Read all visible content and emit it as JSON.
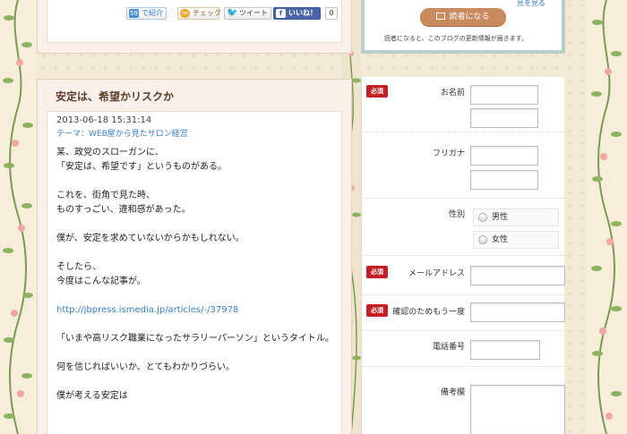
{
  "share": {
    "shokai_label": "で紹介",
    "shokai_icon": "59",
    "check_label": "チェック",
    "check_icon": "m",
    "tweet_label": "ツイート",
    "like_label": "いいね！",
    "like_icon": "f",
    "like_count": "0"
  },
  "reader": {
    "top_link": "見を見る",
    "button_label": "読者になる",
    "note": "読者になると、このブログの更新情報が届きます。"
  },
  "article": {
    "title": "安定は、希望かリスクか",
    "date": "2013-06-18 15:31:14",
    "theme_label": "テーマ：",
    "theme": "WEB屋から見たサロン経営",
    "paragraphs": [
      [
        "某、政党のスローガンに、",
        "「安定は、希望です」というものがある。"
      ],
      [
        "これを、街角で見た時、",
        "ものすっごい、違和感があった。"
      ],
      [
        "僕が、安定を求めていないからかもしれない。"
      ],
      [
        "そしたら、",
        "今度はこんな記事が。"
      ]
    ],
    "link": "http://jbpress.ismedia.jp/articles/-/37978",
    "quote": "「いまや高リスク職業になったサラリーパーソン」というタイトル。",
    "after": "何を信じればいいか、とてもわかりづらい。",
    "tail": "僕が考える安定は"
  },
  "form": {
    "required_label": "必須",
    "name_label": "お名前",
    "furigana_label": "フリガナ",
    "gender_label": "性別",
    "gender_male": "男性",
    "gender_female": "女性",
    "email_label": "メールアドレス",
    "email_confirm_label": "確認のためもう一度",
    "phone_label": "電話番号",
    "remarks_label": "備考欄"
  }
}
